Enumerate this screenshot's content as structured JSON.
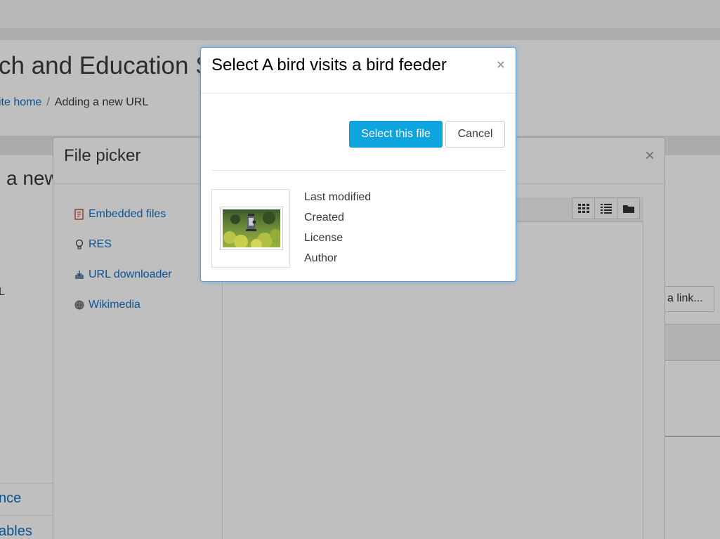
{
  "page": {
    "site_heading": "ch and Education S",
    "breadcrumb": {
      "home": "ite home",
      "separator": "/",
      "current": "Adding a new URL"
    },
    "heading_fragment": "a new",
    "label_fragment": "L",
    "link_button": "a link...",
    "bottom_links": [
      "nce",
      "ables"
    ]
  },
  "file_picker": {
    "title": "File picker",
    "close": "×",
    "repositories": [
      {
        "label": "Embedded files",
        "icon": "embedded-files-icon"
      },
      {
        "label": "RES",
        "icon": "lightbulb-icon"
      },
      {
        "label": "URL downloader",
        "icon": "url-downloader-icon"
      },
      {
        "label": "Wikimedia",
        "icon": "wikimedia-globe-icon"
      }
    ],
    "views": [
      "grid-view-icon",
      "list-view-icon",
      "folder-view-icon"
    ]
  },
  "select_dialog": {
    "title": "Select A bird visits a bird feeder",
    "close": "×",
    "select_button": "Select this file",
    "cancel_button": "Cancel",
    "thumbnail": "bird-feeder-photo",
    "meta": [
      "Last modified",
      "Created",
      "License",
      "Author"
    ]
  },
  "colors": {
    "link": "#0f6fc5",
    "primary": "#0ea5de",
    "modal_border": "#5b9dd9",
    "backdrop": "rgba(0,0,0,0.25)"
  }
}
